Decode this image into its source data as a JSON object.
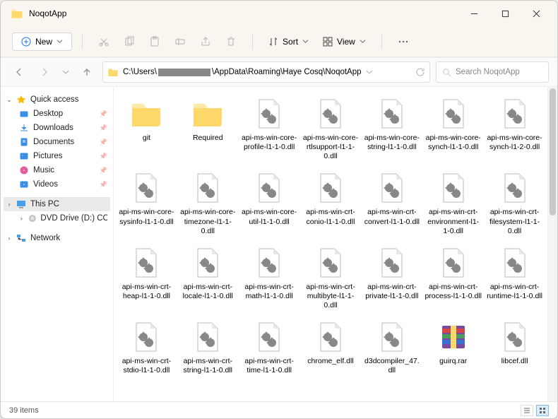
{
  "title": "NoqotApp",
  "toolbar": {
    "new": "New",
    "sort": "Sort",
    "view": "View"
  },
  "path": {
    "prefix": "C:\\Users\\",
    "suffix": "\\AppData\\Roaming\\Haye Cosq\\NoqotApp"
  },
  "search_placeholder": "Search NoqotApp",
  "sidebar": {
    "quick": "Quick access",
    "items": [
      {
        "label": "Desktop"
      },
      {
        "label": "Downloads"
      },
      {
        "label": "Documents"
      },
      {
        "label": "Pictures"
      },
      {
        "label": "Music"
      },
      {
        "label": "Videos"
      }
    ],
    "thispc": "This PC",
    "dvd": "DVD Drive (D:) CCCC",
    "network": "Network"
  },
  "files": [
    {
      "name": "git",
      "type": "folder"
    },
    {
      "name": "Required",
      "type": "folder"
    },
    {
      "name": "api-ms-win-core-profile-l1-1-0.dll",
      "type": "dll"
    },
    {
      "name": "api-ms-win-core-rtlsupport-l1-1-0.dll",
      "type": "dll"
    },
    {
      "name": "api-ms-win-core-string-l1-1-0.dll",
      "type": "dll"
    },
    {
      "name": "api-ms-win-core-synch-l1-1-0.dll",
      "type": "dll"
    },
    {
      "name": "api-ms-win-core-synch-l1-2-0.dll",
      "type": "dll"
    },
    {
      "name": "api-ms-win-core-sysinfo-l1-1-0.dll",
      "type": "dll"
    },
    {
      "name": "api-ms-win-core-timezone-l1-1-0.dll",
      "type": "dll"
    },
    {
      "name": "api-ms-win-core-util-l1-1-0.dll",
      "type": "dll"
    },
    {
      "name": "api-ms-win-crt-conio-l1-1-0.dll",
      "type": "dll"
    },
    {
      "name": "api-ms-win-crt-convert-l1-1-0.dll",
      "type": "dll"
    },
    {
      "name": "api-ms-win-crt-environment-l1-1-0.dll",
      "type": "dll"
    },
    {
      "name": "api-ms-win-crt-filesystem-l1-1-0.dll",
      "type": "dll"
    },
    {
      "name": "api-ms-win-crt-heap-l1-1-0.dll",
      "type": "dll"
    },
    {
      "name": "api-ms-win-crt-locale-l1-1-0.dll",
      "type": "dll"
    },
    {
      "name": "api-ms-win-crt-math-l1-1-0.dll",
      "type": "dll"
    },
    {
      "name": "api-ms-win-crt-multibyte-l1-1-0.dll",
      "type": "dll"
    },
    {
      "name": "api-ms-win-crt-private-l1-1-0.dll",
      "type": "dll"
    },
    {
      "name": "api-ms-win-crt-process-l1-1-0.dll",
      "type": "dll"
    },
    {
      "name": "api-ms-win-crt-runtime-l1-1-0.dll",
      "type": "dll"
    },
    {
      "name": "api-ms-win-crt-stdio-l1-1-0.dll",
      "type": "dll"
    },
    {
      "name": "api-ms-win-crt-string-l1-1-0.dll",
      "type": "dll"
    },
    {
      "name": "api-ms-win-crt-time-l1-1-0.dll",
      "type": "dll"
    },
    {
      "name": "chrome_elf.dll",
      "type": "dll"
    },
    {
      "name": "d3dcompiler_47.dll",
      "type": "dll"
    },
    {
      "name": "guirq.rar",
      "type": "rar"
    },
    {
      "name": "libcef.dll",
      "type": "dll"
    }
  ],
  "status": {
    "count": "39 items"
  },
  "icons": {
    "desktop": "#3a8ee6",
    "downloads": "#3a8ee6",
    "documents": "#3a8ee6",
    "pictures": "#3a8ee6",
    "music": "#e65aa0",
    "videos": "#3a8ee6"
  }
}
